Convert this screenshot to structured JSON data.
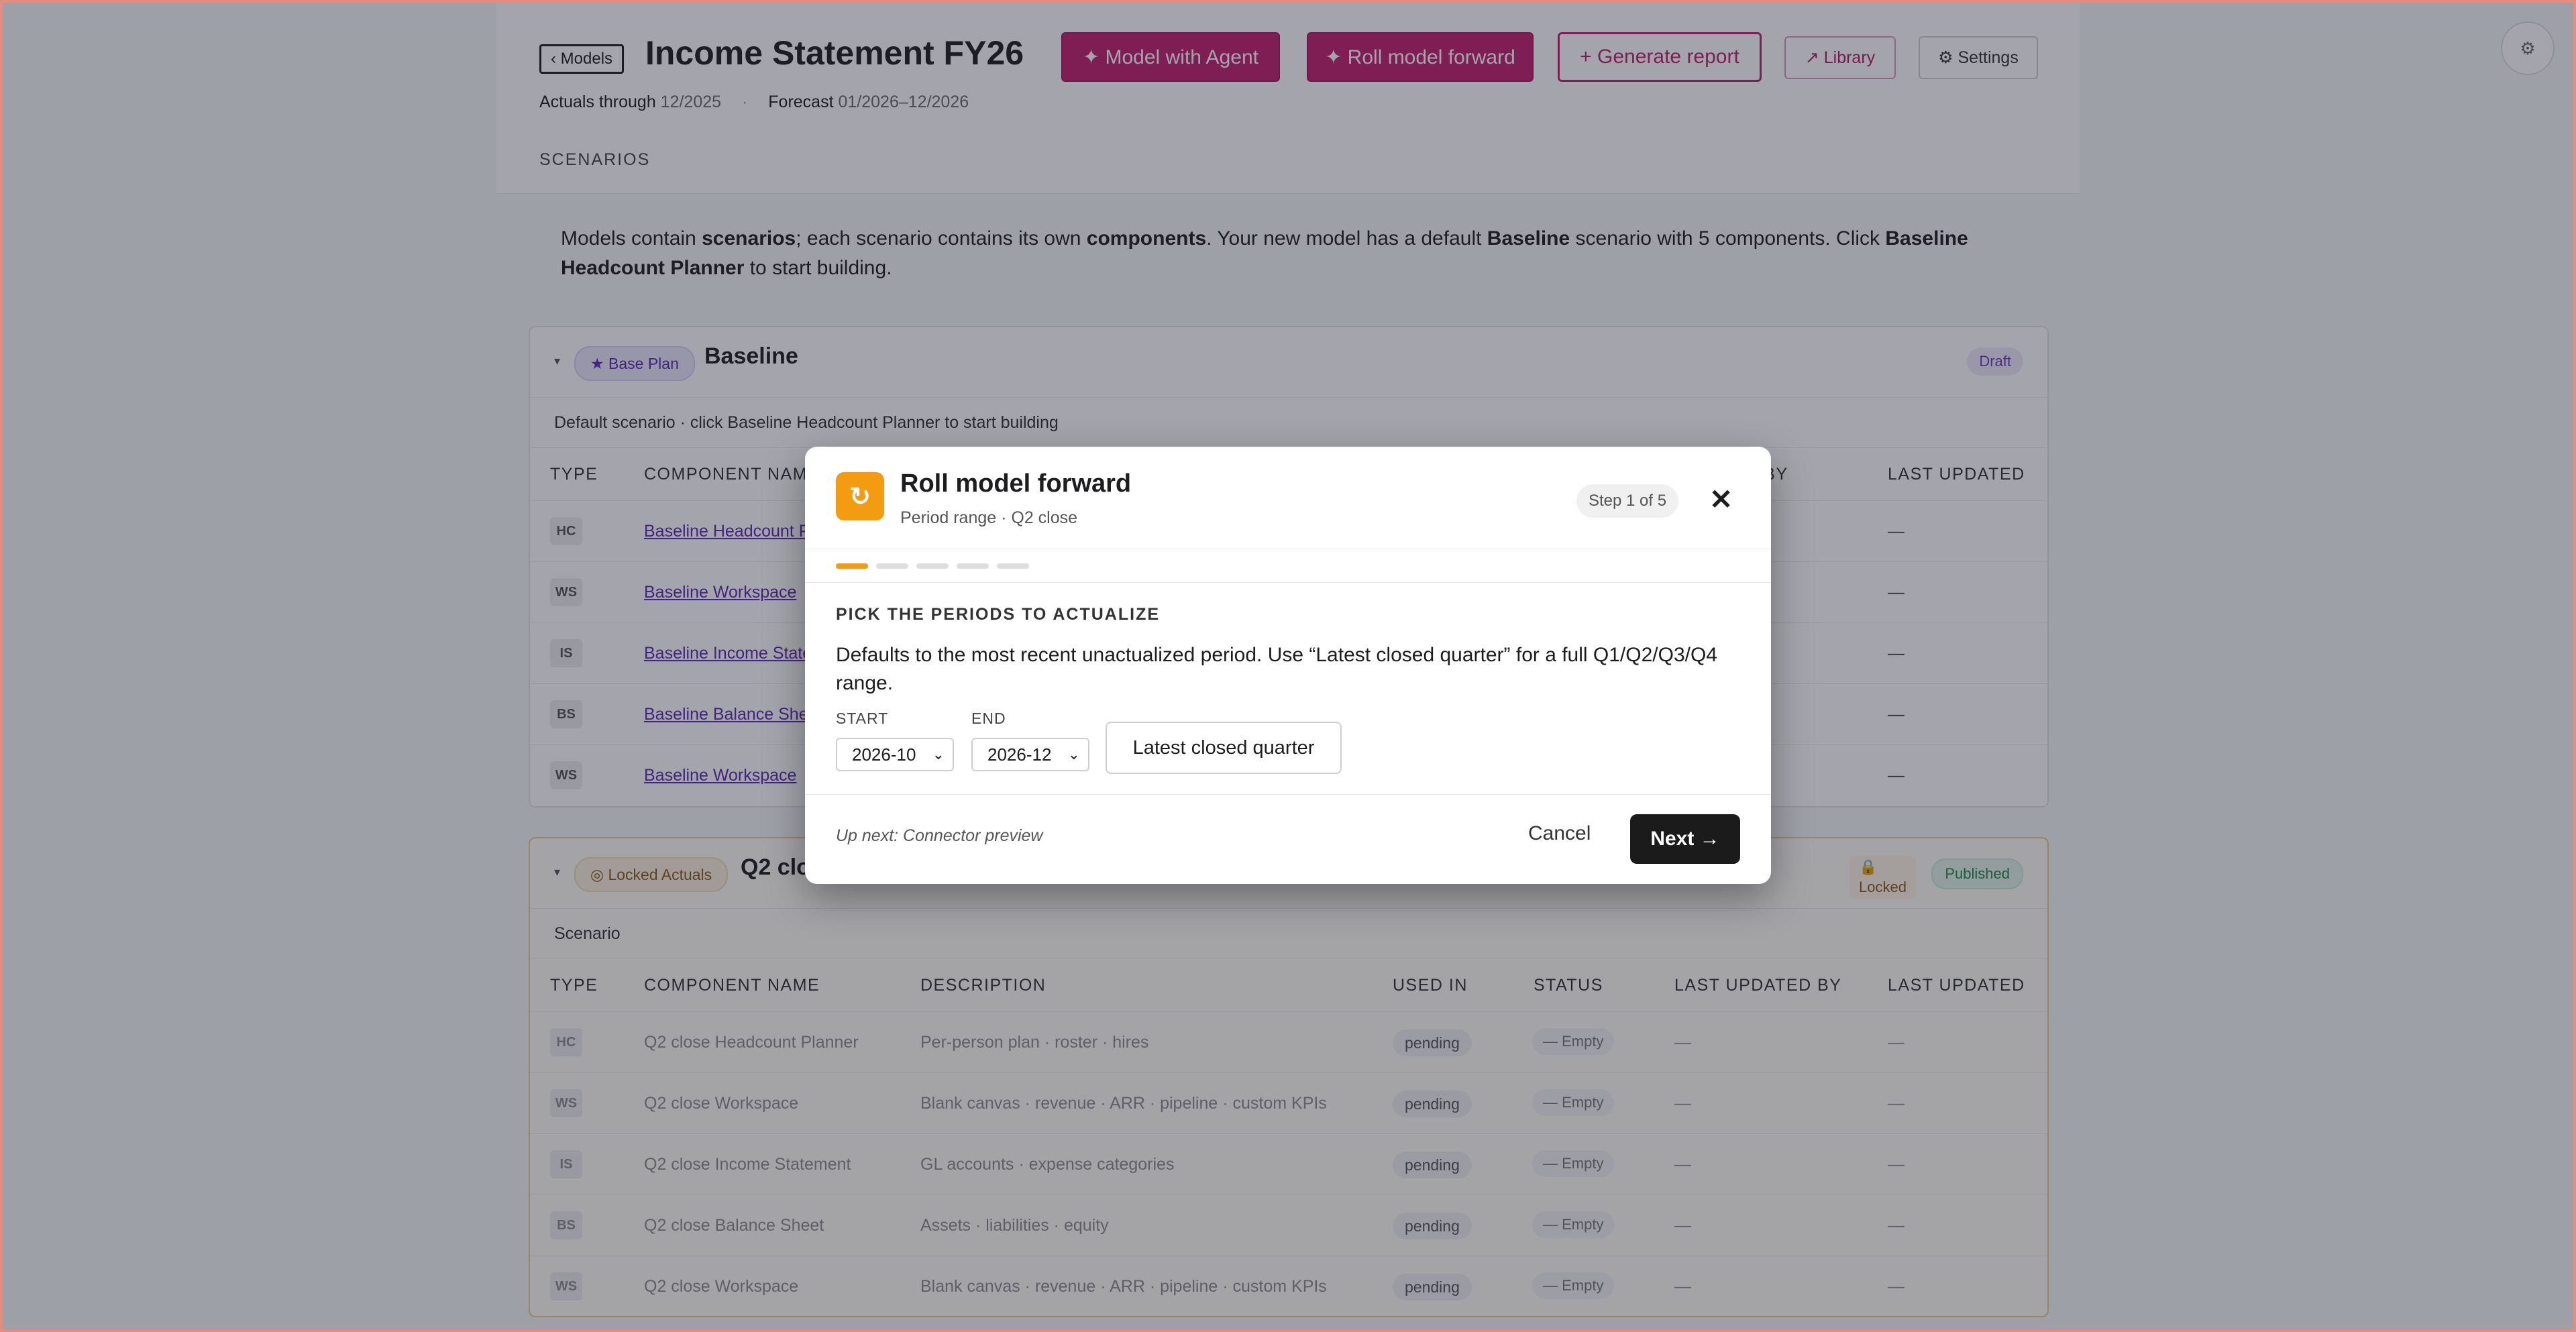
{
  "header": {
    "back_label": "‹ Models",
    "title": "Income Statement FY26",
    "actuals_label": "Actuals through",
    "actuals_value": "12/2025",
    "dot": "·",
    "forecast_label": "Forecast",
    "forecast_value": "01/2026–12/2026",
    "section_label": "SCENARIOS",
    "buttons": {
      "agent": "✦ Model with Agent",
      "roll": "✦ Roll model forward",
      "report": "+ Generate report",
      "library": "↗ Library",
      "settings": "⚙ Settings"
    },
    "corner_icon": "⚙"
  },
  "intro": {
    "p1": "Models contain ",
    "b1": "scenarios",
    "p2": "; each scenario contains its own ",
    "b2": "components",
    "p3": ". Your new model has a default ",
    "b3": "Baseline",
    "p4": " scenario with 5 components. Click ",
    "b4": "Baseline Headcount Planner",
    "p5": " to start building."
  },
  "baseline": {
    "badge": "★ Base Plan",
    "name": "Baseline",
    "status": "Draft",
    "subtitle": "Default scenario · click Baseline Headcount Planner to start building",
    "columns": [
      "TYPE",
      "COMPONENT NAME",
      "ATED BY",
      "LAST UPDATED"
    ],
    "rows": [
      {
        "type": "HC",
        "name": "Baseline Headcount P",
        "updated": "—"
      },
      {
        "type": "WS",
        "name": "Baseline Workspace",
        "updated": "—"
      },
      {
        "type": "IS",
        "name": "Baseline Income State",
        "updated": "—"
      },
      {
        "type": "BS",
        "name": "Baseline Balance She",
        "updated": "—"
      },
      {
        "type": "WS",
        "name": "Baseline Workspace",
        "updated": "—"
      }
    ]
  },
  "q2": {
    "badge": "◎ Locked Actuals",
    "name": "Q2 clo",
    "locked": "🔒\nLocked",
    "status": "Published",
    "subtitle": "Scenario",
    "columns": [
      "TYPE",
      "COMPONENT NAME",
      "DESCRIPTION",
      "USED IN",
      "STATUS",
      "LAST UPDATED BY",
      "LAST UPDATED"
    ],
    "rows": [
      {
        "type": "HC",
        "name": "Q2 close Headcount Planner",
        "desc": "Per-person plan · roster · hires",
        "used": "pending",
        "status": "— Empty",
        "by": "—",
        "updated": "—"
      },
      {
        "type": "WS",
        "name": "Q2 close Workspace",
        "desc": "Blank canvas · revenue · ARR · pipeline · custom KPIs",
        "used": "pending",
        "status": "— Empty",
        "by": "—",
        "updated": "—"
      },
      {
        "type": "IS",
        "name": "Q2 close Income Statement",
        "desc": "GL accounts · expense categories",
        "used": "pending",
        "status": "— Empty",
        "by": "—",
        "updated": "—"
      },
      {
        "type": "BS",
        "name": "Q2 close Balance Sheet",
        "desc": "Assets · liabilities · equity",
        "used": "pending",
        "status": "— Empty",
        "by": "—",
        "updated": "—"
      },
      {
        "type": "WS",
        "name": "Q2 close Workspace",
        "desc": "Blank canvas · revenue · ARR · pipeline · custom KPIs",
        "used": "pending",
        "status": "— Empty",
        "by": "—",
        "updated": "—"
      }
    ]
  },
  "modal": {
    "icon": "↻",
    "title": "Roll model forward",
    "subtitle": "Period range · Q2 close",
    "step": "Step 1 of 5",
    "close": "✕",
    "progress": {
      "current": 1,
      "total": 5
    },
    "section_label": "PICK THE PERIODS TO ACTUALIZE",
    "description": "Defaults to the most recent unactualized period. Use “Latest closed quarter” for a full Q1/Q2/Q3/Q4 range.",
    "start_label": "START",
    "start_value": "2026-10",
    "end_label": "END",
    "end_value": "2026-12",
    "latest_button": "Latest closed quarter",
    "up_next": "Up next: Connector preview",
    "cancel": "Cancel",
    "next": "Next →"
  },
  "colors": {
    "accent": "#c11f6f",
    "modal_icon": "#f39c12",
    "purple_link": "#5a2bb3"
  }
}
